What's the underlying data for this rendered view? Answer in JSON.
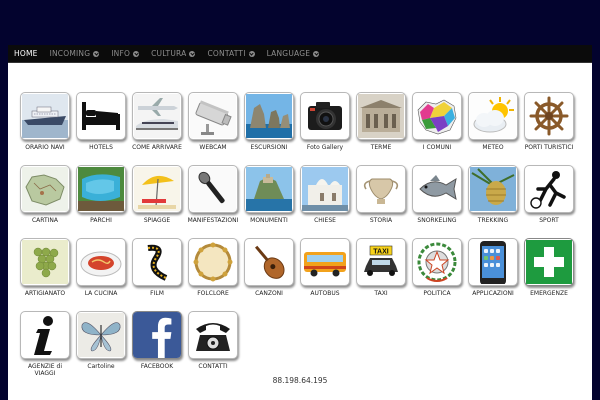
{
  "nav": {
    "items": [
      {
        "label": "HOME",
        "dropdown": false,
        "active": true
      },
      {
        "label": "INCOMING",
        "dropdown": true,
        "active": false
      },
      {
        "label": "INFO",
        "dropdown": true,
        "active": false
      },
      {
        "label": "CULTURA",
        "dropdown": true,
        "active": false
      },
      {
        "label": "CONTATTI",
        "dropdown": true,
        "active": false
      },
      {
        "label": "LANGUAGE",
        "dropdown": true,
        "active": false
      }
    ]
  },
  "tiles": [
    {
      "label": "ORARIO NAVI",
      "icon": "ship-icon"
    },
    {
      "label": "HOTELS",
      "icon": "bed-icon"
    },
    {
      "label": "COME ARRIVARE",
      "icon": "airplane-train-icon"
    },
    {
      "label": "WEBCAM",
      "icon": "webcam-icon"
    },
    {
      "label": "ESCURSIONI",
      "icon": "faraglioni-rocks-icon"
    },
    {
      "label": "Foto Gallery",
      "icon": "camera-icon"
    },
    {
      "label": "TERME",
      "icon": "thermal-building-icon"
    },
    {
      "label": "I COMUNI",
      "icon": "island-map-icon"
    },
    {
      "label": "METEO",
      "icon": "sun-cloud-icon"
    },
    {
      "label": "PORTI TURISTICI",
      "icon": "ship-wheel-icon"
    },
    {
      "label": "CARTINA",
      "icon": "island-map-photo-icon"
    },
    {
      "label": "PARCHI",
      "icon": "park-pool-icon"
    },
    {
      "label": "SPIAGGE",
      "icon": "beach-umbrella-icon"
    },
    {
      "label": "MANIFESTAZIONI",
      "icon": "microphone-icon"
    },
    {
      "label": "MONUMENTI",
      "icon": "castle-island-icon"
    },
    {
      "label": "CHIESE",
      "icon": "church-icon"
    },
    {
      "label": "STORIA",
      "icon": "ancient-vase-icon"
    },
    {
      "label": "SNORKELING",
      "icon": "fish-icon"
    },
    {
      "label": "TREKKING",
      "icon": "pine-cone-icon"
    },
    {
      "label": "SPORT",
      "icon": "football-player-icon"
    },
    {
      "label": "ARTIGIANATO",
      "icon": "grapes-icon"
    },
    {
      "label": "LA CUCINA",
      "icon": "pasta-plate-icon"
    },
    {
      "label": "FILM",
      "icon": "film-reel-icon"
    },
    {
      "label": "FOLCLORE",
      "icon": "tambourine-icon"
    },
    {
      "label": "CANZONI",
      "icon": "mandolin-icon"
    },
    {
      "label": "AUTOBUS",
      "icon": "bus-icon"
    },
    {
      "label": "TAXI",
      "icon": "taxi-icon"
    },
    {
      "label": "POLITICA",
      "icon": "italian-emblem-icon"
    },
    {
      "label": "APPLICAZIONI",
      "icon": "smartphone-icon"
    },
    {
      "label": "EMERGENZE",
      "icon": "first-aid-cross-icon"
    },
    {
      "label": "AGENZIE di VIAGGI",
      "icon": "info-i-icon"
    },
    {
      "label": "Cartoline",
      "icon": "butterfly-postcard-icon"
    },
    {
      "label": "FACEBOOK",
      "icon": "facebook-icon"
    },
    {
      "label": "CONTATTI",
      "icon": "telephone-icon"
    }
  ],
  "footer": {
    "ip": "88.198.64.195"
  }
}
